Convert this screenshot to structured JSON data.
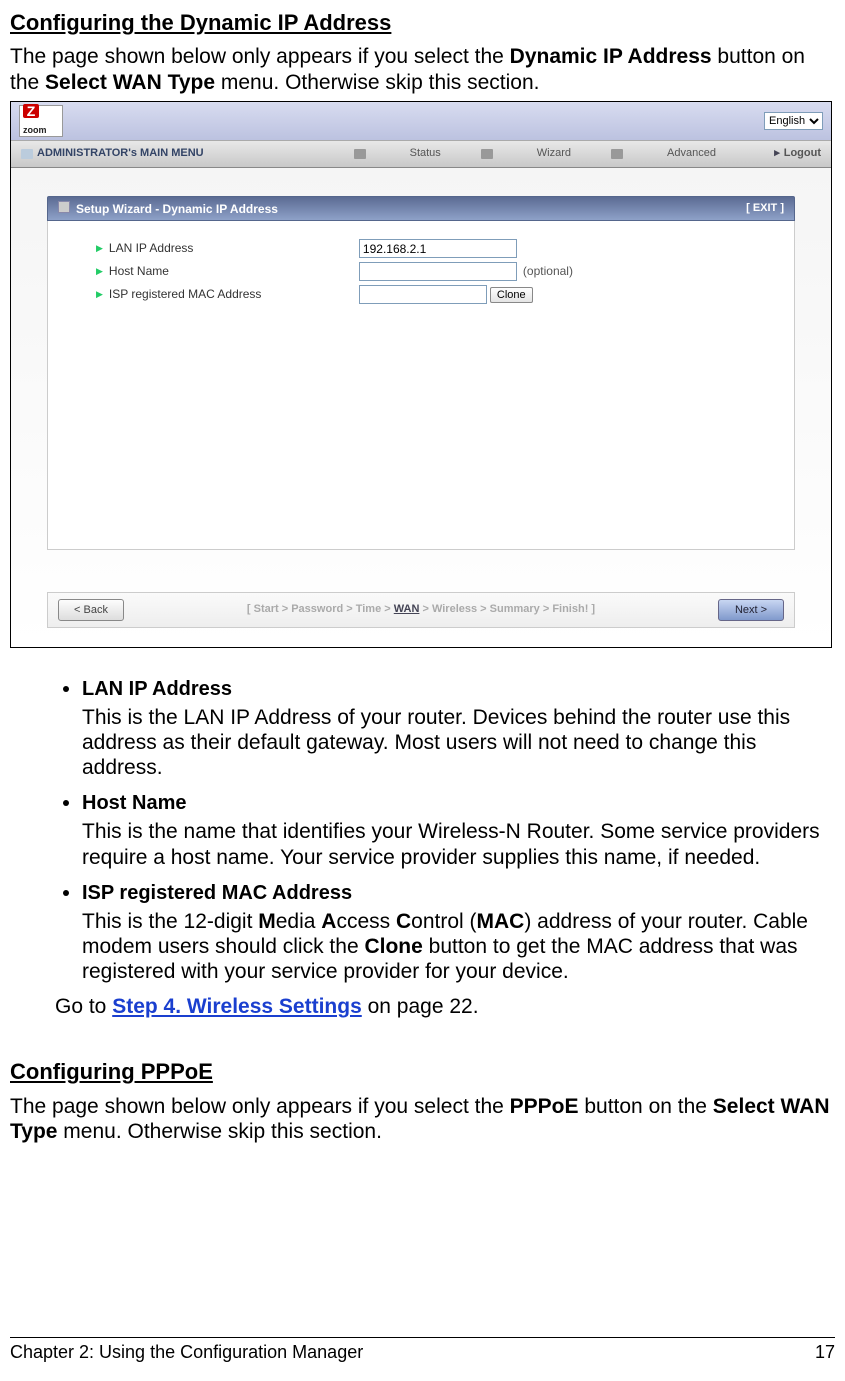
{
  "section1_title": "Configuring the Dynamic IP Address ",
  "intro1_a": "The page shown below only appears if you select the ",
  "intro1_b": "Dynamic IP Address",
  "intro1_c": " button on the ",
  "intro1_d": "Select WAN Type",
  "intro1_e": " menu. Otherwise skip this section.",
  "shot": {
    "logo_text": "zoom",
    "lang": "English",
    "main_menu_label": "ADMINISTRATOR's MAIN MENU",
    "menu_status": "Status",
    "menu_wizard": "Wizard",
    "menu_advanced": "Advanced",
    "menu_logout": "Logout",
    "panel_title": "Setup Wizard - Dynamic IP Address",
    "exit_label": "[ EXIT ]",
    "row_lanip": "LAN IP Address",
    "row_lanip_val": "192.168.2.1",
    "row_host": "Host Name",
    "row_host_optional": "(optional)",
    "row_mac": "ISP registered MAC Address",
    "clone_btn": "Clone",
    "back_btn": "< Back",
    "next_btn": "Next >",
    "steps_a": "[ Start > Password > Time > ",
    "steps_current": "WAN",
    "steps_b": " > Wireless > Summary > Finish! ]"
  },
  "bullets": {
    "lanip_head": "LAN IP Address",
    "lanip_text": "This is the LAN IP Address of your router. Devices behind the router use this address as their default gateway. Most users will not need to change this address.",
    "host_head": "Host Name",
    "host_text": "This is the name that identifies your Wireless-N Router. Some service providers require a host name. Your service provider supplies this name, if needed.",
    "mac_head": "ISP registered MAC Address",
    "mac_a": "This is the 12-digit ",
    "mac_b": "M",
    "mac_c": "edia ",
    "mac_d": "A",
    "mac_e": "ccess ",
    "mac_f": "C",
    "mac_g": "ontrol (",
    "mac_h": "MAC",
    "mac_i": ") address of your router. Cable modem users should click the ",
    "mac_j": "Clone",
    "mac_k": " button to get the MAC address that was registered with your service provider for your device."
  },
  "goto_a": "Go to ",
  "goto_link": "Step 4. Wireless Settings",
  "goto_b": " on page 22.",
  "section2_title": "Configuring PPPoE  ",
  "intro2_a": "The page shown below only appears if you select the ",
  "intro2_b": "PPPoE",
  "intro2_c": " button on the ",
  "intro2_d": "Select WAN Type",
  "intro2_e": " menu. Otherwise skip this section.",
  "footer_chapter": "Chapter 2: Using the Configuration Manager",
  "footer_page": "17"
}
